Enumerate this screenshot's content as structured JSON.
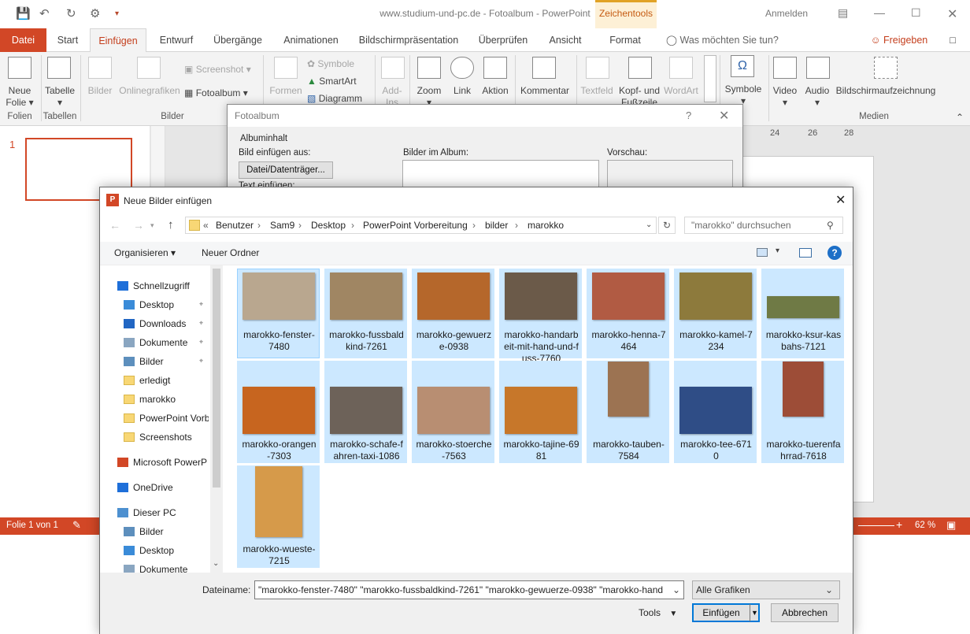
{
  "window": {
    "title": "www.studium-und-pc.de - Fotoalbum - PowerPoint",
    "contextual_tab_group": "Zeichentools",
    "signin": "Anmelden"
  },
  "tabs": [
    "Datei",
    "Start",
    "Einfügen",
    "Entwurf",
    "Übergänge",
    "Animationen",
    "Bildschirmpräsentation",
    "Überprüfen",
    "Ansicht",
    "Format"
  ],
  "tell_me": "Was möchten Sie tun?",
  "share": "Freigeben",
  "ribbon": {
    "neue_folie": [
      "Neue",
      "Folie"
    ],
    "tabelle": "Tabelle",
    "bilder": "Bilder",
    "onlinegrafiken": "Onlinegrafiken",
    "screenshot": "Screenshot",
    "fotoalbum": "Fotoalbum",
    "formen": "Formen",
    "symbole_small": "Symbole",
    "smartart": "SmartArt",
    "diagramm": "Diagramm",
    "addins": "Add-Ins",
    "zoom": "Zoom",
    "link": "Link",
    "aktion": "Aktion",
    "kommentar": "Kommentar",
    "textfeld": "Textfeld",
    "kopf_fusszeile": "Kopf- und Fußzeile",
    "wordart": "WordArt",
    "symbole": "Symbole",
    "video": "Video",
    "audio": "Audio",
    "bildschirmaufzeichnung": "Bildschirmaufzeichnung",
    "groups": {
      "folien": "Folien",
      "tabellen": "Tabellen",
      "bilder": "Bilder",
      "medien": "Medien"
    }
  },
  "slide_number": "1",
  "ruler": {
    "t24": "24",
    "t26": "26",
    "t28": "28"
  },
  "status": {
    "slide": "Folie 1 von 1",
    "zoom": "62 %"
  },
  "fotoalbum": {
    "title": "Fotoalbum",
    "help": "?",
    "section": "Albuminhalt",
    "insert_from": "Bild einfügen aus:",
    "file_button": "Datei/Datenträger...",
    "insert_text": "Text einfügen:",
    "pictures_in_album": "Bilder im Album:",
    "preview": "Vorschau:"
  },
  "dialog": {
    "title": "Neue Bilder einfügen",
    "path": [
      "«",
      "Benutzer",
      "Sam9",
      "Desktop",
      "PowerPoint Vorbereitung",
      "bilder",
      "marokko"
    ],
    "search_placeholder": "\"marokko\" durchsuchen",
    "organize": "Organisieren",
    "new_folder": "Neuer Ordner",
    "nav": [
      {
        "label": "Schnellzugriff",
        "icon": "star-icon"
      },
      {
        "label": "Desktop",
        "icon": "desktop-icon"
      },
      {
        "label": "Downloads",
        "icon": "download-icon"
      },
      {
        "label": "Dokumente",
        "icon": "document-icon"
      },
      {
        "label": "Bilder",
        "icon": "pictures-icon"
      },
      {
        "label": "erledigt",
        "icon": "folder-icon"
      },
      {
        "label": "marokko",
        "icon": "folder-icon"
      },
      {
        "label": "PowerPoint Vorb",
        "icon": "folder-icon"
      },
      {
        "label": "Screenshots",
        "icon": "folder-icon"
      },
      {
        "label": "Microsoft PowerP",
        "icon": "powerpoint-icon"
      },
      {
        "label": "OneDrive",
        "icon": "cloud-icon"
      },
      {
        "label": "Dieser PC",
        "icon": "computer-icon"
      },
      {
        "label": "Bilder",
        "icon": "pictures-icon"
      },
      {
        "label": "Desktop",
        "icon": "desktop-icon"
      },
      {
        "label": "Dokumente",
        "icon": "document-icon"
      }
    ],
    "files": [
      {
        "name": "marokko-fenster-7480",
        "color": "#b9a78f"
      },
      {
        "name": "marokko-fussbaldkind-7261",
        "color": "#a08663"
      },
      {
        "name": "marokko-gewuerze-0938",
        "color": "#b5672b"
      },
      {
        "name": "marokko-handarbeit-mit-hand-und-fuss-7760",
        "color": "#6b5a49"
      },
      {
        "name": "marokko-henna-7464",
        "color": "#b15b43"
      },
      {
        "name": "marokko-kamel-7234",
        "color": "#8d7a3c"
      },
      {
        "name": "marokko-ksur-kasbahs-7121",
        "color": "#6f7a45"
      },
      {
        "name": "marokko-orangen-7303",
        "color": "#c7651f"
      },
      {
        "name": "marokko-schafe-fahren-taxi-1086",
        "color": "#6d6259"
      },
      {
        "name": "marokko-stoerche-7563",
        "color": "#b88e72"
      },
      {
        "name": "marokko-tajine-6981",
        "color": "#c7772a"
      },
      {
        "name": "marokko-tauben-7584",
        "color": "#9c7352"
      },
      {
        "name": "marokko-tee-6710",
        "color": "#2f4d86"
      },
      {
        "name": "marokko-tuerenfahrrad-7618",
        "color": "#9d4d37"
      },
      {
        "name": "marokko-wueste-7215",
        "color": "#d69a4a"
      }
    ],
    "filename_label": "Dateiname:",
    "filename_value": "\"marokko-fenster-7480\" \"marokko-fussbaldkind-7261\" \"marokko-gewuerze-0938\" \"marokko-hand",
    "filetype": "Alle Grafiken",
    "tools": "Tools",
    "insert": "Einfügen",
    "cancel": "Abbrechen"
  }
}
